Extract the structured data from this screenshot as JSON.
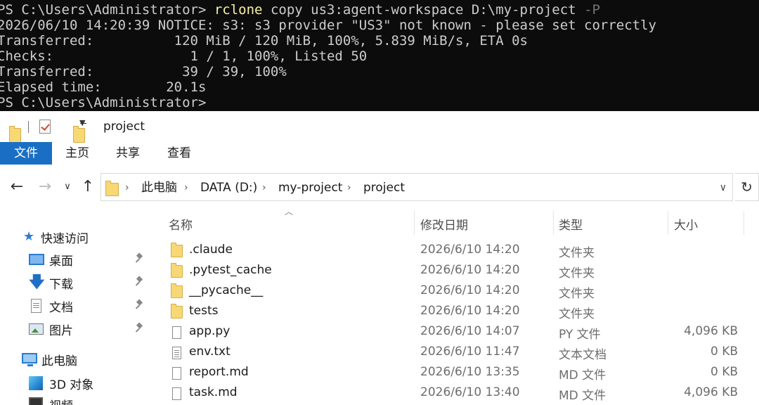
{
  "terminal": {
    "lines": [
      {
        "prompt": "PS C:\\Users\\Administrator> ",
        "command": "rclone",
        "args": " copy us3:agent-workspace D:\\my-project ",
        "flag": "-P"
      },
      {
        "text": "2026/06/10 14:20:39 NOTICE: s3: s3 provider \"US3\" not known - please set correctly"
      },
      {
        "text": "Transferred:          120 MiB / 120 MiB, 100%, 5.839 MiB/s, ETA 0s"
      },
      {
        "text": "Checks:                 1 / 1, 100%, Listed 50"
      },
      {
        "text": "Transferred:           39 / 39, 100%"
      },
      {
        "text": "Elapsed time:        20.1s"
      },
      {
        "prompt": "PS C:\\Users\\Administrator>"
      }
    ]
  },
  "explorer": {
    "window_title": "project",
    "ribbon_tabs": [
      "文件",
      "主页",
      "共享",
      "查看"
    ],
    "breadcrumb": [
      "此电脑",
      "DATA (D:)",
      "my-project",
      "project"
    ],
    "nav": {
      "quick_access": "快速访问",
      "items": [
        "桌面",
        "下载",
        "文档",
        "图片"
      ],
      "this_pc": "此电脑",
      "pc_items": [
        "3D 对象",
        "视频"
      ]
    },
    "columns": {
      "name": "名称",
      "modified": "修改日期",
      "type": "类型",
      "size": "大小"
    },
    "files": [
      {
        "name": ".claude",
        "modified": "2026/6/10 14:20",
        "type": "文件夹",
        "size": "",
        "kind": "folder"
      },
      {
        "name": ".pytest_cache",
        "modified": "2026/6/10 14:20",
        "type": "文件夹",
        "size": "",
        "kind": "folder"
      },
      {
        "name": "__pycache__",
        "modified": "2026/6/10 14:20",
        "type": "文件夹",
        "size": "",
        "kind": "folder"
      },
      {
        "name": "tests",
        "modified": "2026/6/10 14:20",
        "type": "文件夹",
        "size": "",
        "kind": "folder"
      },
      {
        "name": "app.py",
        "modified": "2026/6/10 14:07",
        "type": "PY 文件",
        "size": "4,096 KB",
        "kind": "file"
      },
      {
        "name": "env.txt",
        "modified": "2026/6/10 11:47",
        "type": "文本文档",
        "size": "0 KB",
        "kind": "textfile"
      },
      {
        "name": "report.md",
        "modified": "2026/6/10 13:35",
        "type": "MD 文件",
        "size": "0 KB",
        "kind": "file"
      },
      {
        "name": "task.md",
        "modified": "2026/6/10 13:40",
        "type": "MD 文件",
        "size": "4,096 KB",
        "kind": "file"
      }
    ]
  },
  "colors": {
    "ribbon_active": "#1a6fc4",
    "terminal_bg": "#0c0c0c",
    "command": "#f9f1a5",
    "folder": "#f8d775"
  }
}
